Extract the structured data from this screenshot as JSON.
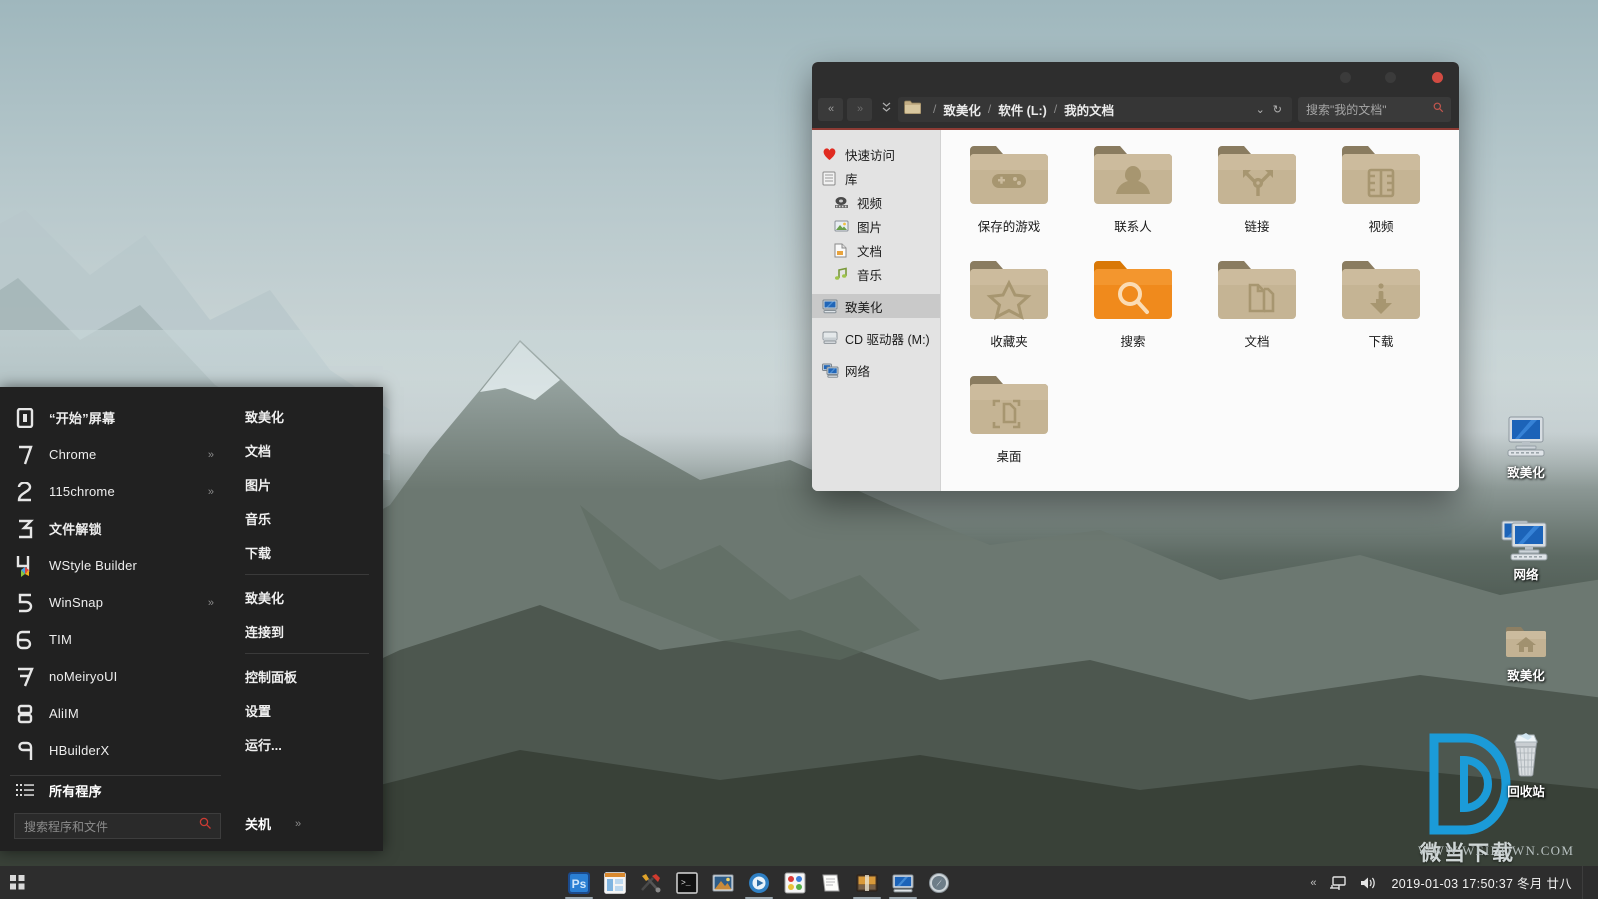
{
  "desktop": {
    "icons": [
      {
        "name": "致美化",
        "icon": "computer-icon"
      },
      {
        "name": "网络",
        "icon": "network-icon"
      },
      {
        "name": "致美化",
        "icon": "home-folder-icon"
      },
      {
        "name": "回收站",
        "icon": "recycle-bin-icon"
      }
    ],
    "watermark_text": "微当下载",
    "watermark_url": "WWW.WEIDOWN.COM",
    "watermark_logo": "letter-d-logo",
    "accent_blue": "#1b9bd8"
  },
  "start_menu": {
    "programs": [
      {
        "index": "0",
        "label": "“开始”屏幕",
        "bold": true,
        "arrow": ""
      },
      {
        "index": "1",
        "label": "Chrome",
        "bold": false,
        "arrow": "»"
      },
      {
        "index": "2",
        "label": "115chrome",
        "bold": false,
        "arrow": "»"
      },
      {
        "index": "3",
        "label": "文件解锁",
        "bold": true,
        "arrow": ""
      },
      {
        "index": "4",
        "label": "WStyle Builder",
        "bold": false,
        "arrow": ""
      },
      {
        "index": "5",
        "label": "WinSnap",
        "bold": false,
        "arrow": "»"
      },
      {
        "index": "6",
        "label": "TIM",
        "bold": false,
        "arrow": ""
      },
      {
        "index": "7",
        "label": "noMeiryoUI",
        "bold": false,
        "arrow": ""
      },
      {
        "index": "8",
        "label": "AliIM",
        "bold": false,
        "arrow": ""
      },
      {
        "index": "9",
        "label": "HBuilderX",
        "bold": false,
        "arrow": ""
      }
    ],
    "all_programs": "所有程序",
    "search_placeholder": "搜索程序和文件",
    "right_items": [
      {
        "label": "致美化",
        "sep_after": false
      },
      {
        "label": "文档",
        "sep_after": false
      },
      {
        "label": "图片",
        "sep_after": false
      },
      {
        "label": "音乐",
        "sep_after": false
      },
      {
        "label": "下载",
        "sep_after": true
      },
      {
        "label": "致美化",
        "sep_after": false
      },
      {
        "label": "连接到",
        "sep_after": true
      },
      {
        "label": "控制面板",
        "sep_after": false
      },
      {
        "label": "设置",
        "sep_after": false
      },
      {
        "label": "运行...",
        "sep_after": false
      }
    ],
    "power_label": "关机",
    "power_arrow": "»"
  },
  "explorer": {
    "nav": {
      "back": "«",
      "forward": "»",
      "history": "⌄"
    },
    "breadcrumb": [
      "致美化",
      "软件 (L:)",
      "我的文档"
    ],
    "breadcrumb_sep": "/",
    "dropdown_glyph": "⌄",
    "refresh_glyph": "↻",
    "search_placeholder": "搜索\"我的文档\"",
    "window_controls": [
      "minimize",
      "maximize",
      "close"
    ],
    "close_color": "#d24b42",
    "accent_line": "#8d3b34",
    "sidebar": [
      {
        "label": "快速访问",
        "icon": "heart-icon",
        "indent": false,
        "selected": false
      },
      {
        "label": "库",
        "icon": "library-icon",
        "indent": false,
        "selected": false
      },
      {
        "label": "视频",
        "icon": "video-icon",
        "indent": true,
        "selected": false
      },
      {
        "label": "图片",
        "icon": "picture-icon",
        "indent": true,
        "selected": false
      },
      {
        "label": "文档",
        "icon": "document-icon",
        "indent": true,
        "selected": false
      },
      {
        "label": "音乐",
        "icon": "music-icon",
        "indent": true,
        "selected": false
      },
      {
        "label": "致美化",
        "icon": "computer-icon",
        "indent": false,
        "selected": true
      },
      {
        "label": "CD 驱动器 (M:)",
        "icon": "cd-drive-icon",
        "indent": false,
        "selected": false
      },
      {
        "label": "网络",
        "icon": "network-icon",
        "indent": false,
        "selected": false
      }
    ],
    "folders": [
      {
        "label": "保存的游戏",
        "glyph": "gamepad-icon",
        "color": "tan"
      },
      {
        "label": "联系人",
        "glyph": "contact-icon",
        "color": "tan"
      },
      {
        "label": "链接",
        "glyph": "links-icon",
        "color": "tan"
      },
      {
        "label": "视频",
        "glyph": "film-icon",
        "color": "tan"
      },
      {
        "label": "收藏夹",
        "glyph": "star-icon",
        "color": "tan"
      },
      {
        "label": "搜索",
        "glyph": "search-icon",
        "color": "orange"
      },
      {
        "label": "文档",
        "glyph": "pages-icon",
        "color": "tan"
      },
      {
        "label": "下载",
        "glyph": "download-icon",
        "color": "tan"
      },
      {
        "label": "桌面",
        "glyph": "desktop-icon",
        "color": "tan"
      }
    ],
    "folder_tan": "#bfae94",
    "folder_orange": "#f08a1c"
  },
  "taskbar": {
    "start_icon": "start-grid-icon",
    "apps": [
      {
        "name": "photoshop",
        "active": true
      },
      {
        "name": "file-manager",
        "active": false
      },
      {
        "name": "tools",
        "active": false
      },
      {
        "name": "terminal",
        "active": false
      },
      {
        "name": "photo-viewer",
        "active": false
      },
      {
        "name": "media-player",
        "active": true
      },
      {
        "name": "paint",
        "active": false
      },
      {
        "name": "notes",
        "active": false
      },
      {
        "name": "archive",
        "active": true
      },
      {
        "name": "computer",
        "active": true
      },
      {
        "name": "browser",
        "active": false
      }
    ],
    "tray_expand": "«",
    "tray_icons": [
      "network-tray-icon",
      "volume-tray-icon"
    ],
    "clock": "2019-01-03  17:50:37  冬月 廿八"
  }
}
